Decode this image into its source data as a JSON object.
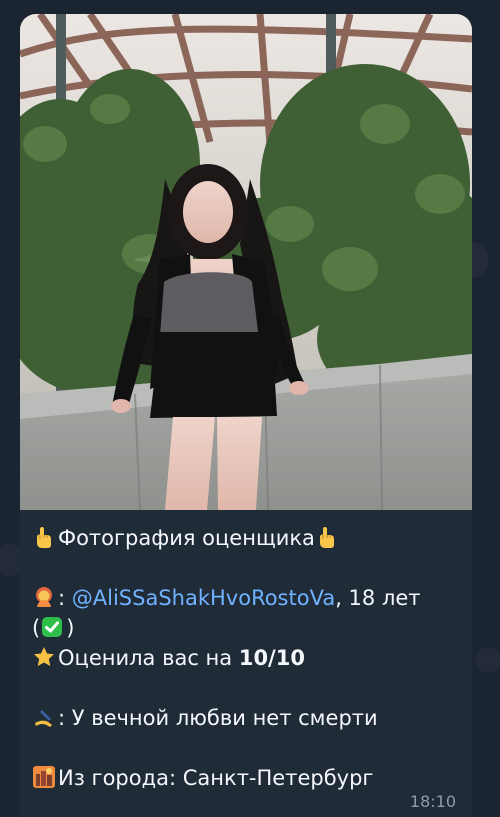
{
  "chat": {
    "photo_alt": "Фотография",
    "caption": {
      "title": "Фотография оценщика",
      "user_separator": ":",
      "username": "@AliSSaShakHvoRostoVa",
      "age_text": ", 18 лет",
      "rating_prefix": "Оценила вас на ",
      "rating_value": "10/10",
      "quote_separator": ":",
      "quote": " У вечной любви нет смерти",
      "city_text": "Из города: Санкт-Петербург"
    },
    "time": "18:10",
    "icons": {
      "title_left": "pointing-up-icon",
      "title_right": "pointing-up-icon",
      "user": "woman-icon",
      "verified": "check-mark-icon",
      "rating": "star-icon",
      "quote": "writing-hand-icon",
      "city": "cityscape-icon"
    },
    "colors": {
      "background": "#1b2431",
      "bubble": "#202b38",
      "text": "#f4f7fb",
      "link": "#6fb2ff",
      "time": "#8e9aaa"
    }
  }
}
